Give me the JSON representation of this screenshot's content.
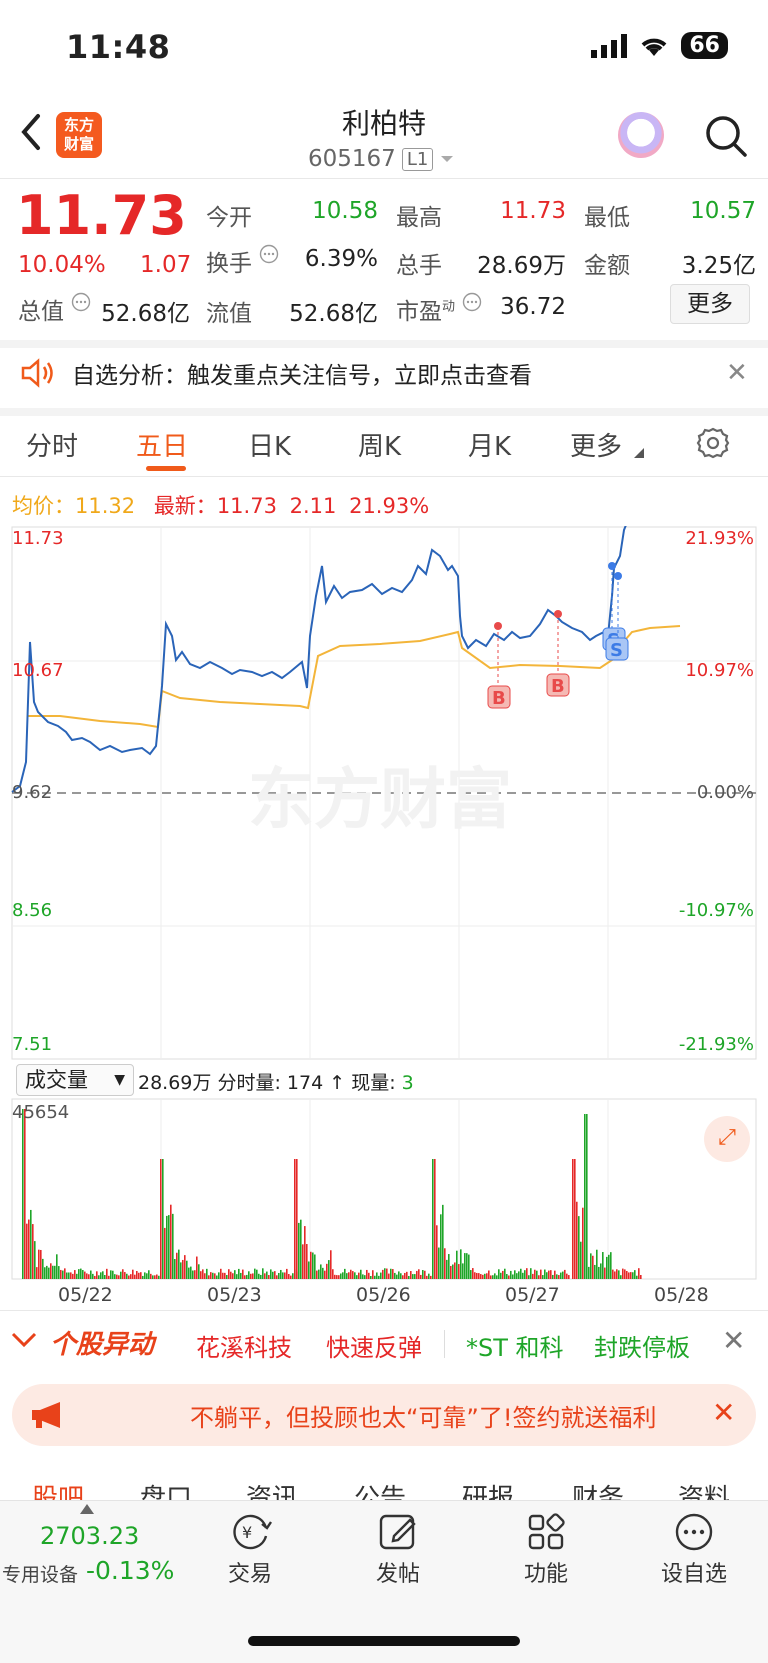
{
  "status_bar": {
    "time": "11:48",
    "battery": "66"
  },
  "header": {
    "title": "利柏特",
    "code": "605167",
    "level": "L1",
    "logo_text": "东方财富"
  },
  "quote": {
    "price": "11.73",
    "change_pct": "10.04%",
    "change": "1.07",
    "open_label": "今开",
    "open": "10.58",
    "high_label": "最高",
    "high": "11.73",
    "low_label": "最低",
    "low": "10.57",
    "turnover_label": "换手",
    "turnover": "6.39%",
    "volume_label": "总手",
    "volume": "28.69万",
    "amount_label": "金额",
    "amount": "3.25亿",
    "mcap_label": "总值",
    "mcap": "52.68亿",
    "float_label": "流值",
    "float_mcap": "52.68亿",
    "pe_label": "市盈",
    "pe_sup": "动",
    "pe": "36.72",
    "more_label": "更多"
  },
  "notice": {
    "text": "自选分析：触发重点关注信号，立即点击查看"
  },
  "tabs": [
    "分时",
    "五日",
    "日K",
    "周K",
    "月K",
    "更多"
  ],
  "active_tab": "五日",
  "chart_header": {
    "avg_label": "均价：",
    "avg": "11.32",
    "latest_label": "最新：",
    "latest": "11.73",
    "latest_chg": "2.11",
    "latest_pct": "21.93%"
  },
  "chart_data": {
    "type": "line",
    "y_left_labels": [
      "11.73",
      "10.67",
      "9.62",
      "8.56",
      "7.51"
    ],
    "y_right_labels": [
      "21.93%",
      "10.97%",
      "0.00%",
      "-10.97%",
      "-21.93%"
    ],
    "x_labels": [
      "05/22",
      "05/23",
      "05/26",
      "05/27",
      "05/28"
    ],
    "series": [
      {
        "name": "price",
        "color": "#2a64b8"
      },
      {
        "name": "avg",
        "color": "#f3b53a"
      }
    ],
    "markers": [
      "B",
      "B",
      "S",
      "S"
    ],
    "volume_max_label": "45654"
  },
  "volume_bar": {
    "selector": "成交量",
    "total": "28.69万",
    "minute_label": "分时量:",
    "minute": "174",
    "arrow": "↑",
    "now_label": "现量:",
    "now": "3"
  },
  "movers": {
    "title": "个股异动",
    "items": [
      {
        "name": "花溪科技",
        "color": "#e52828"
      },
      {
        "name": "快速反弹",
        "color": "#e52828"
      },
      {
        "name": "*ST 和科",
        "color": "#1ea528"
      },
      {
        "name": "封跌停板",
        "color": "#1ea528"
      }
    ]
  },
  "ad": {
    "text": "不躺平，但投顾也太“可靠”了!签约就送福利"
  },
  "sub_tabs": [
    "股吧",
    "盘口",
    "资讯",
    "公告",
    "研报",
    "财务",
    "资料"
  ],
  "bottom": {
    "index_value": "2703.23",
    "index_label": "专用设备",
    "index_change": "-0.13%",
    "items": [
      "交易",
      "发帖",
      "功能",
      "设自选"
    ]
  }
}
